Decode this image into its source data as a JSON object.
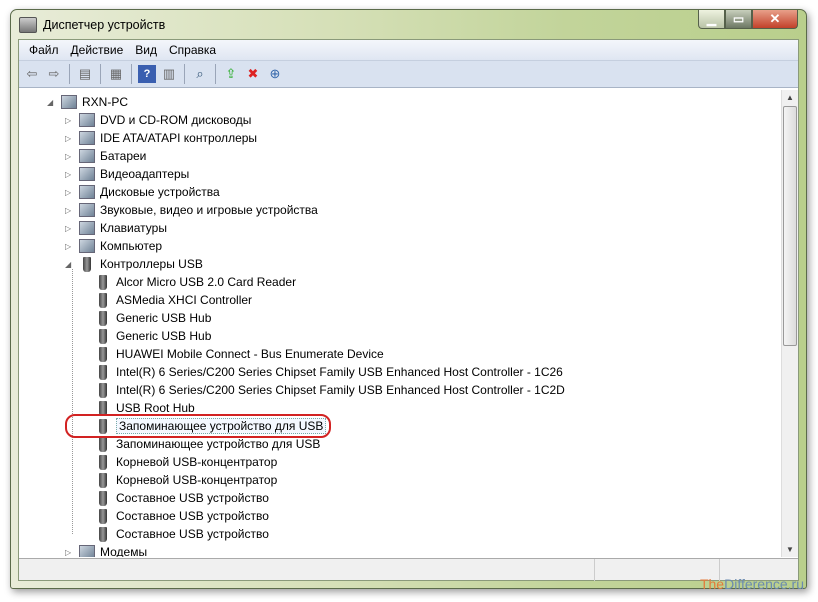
{
  "window": {
    "title": "Диспетчер устройств"
  },
  "menu": [
    "Файл",
    "Действие",
    "Вид",
    "Справка"
  ],
  "toolbar": [
    "back-icon",
    "forward-icon",
    "show-hide-tree-icon",
    "properties-icon",
    "help-icon",
    "action-pane-icon",
    "scan-hardware-icon",
    "update-driver-icon",
    "disable-device-icon",
    "uninstall-device-icon"
  ],
  "tree": {
    "root": "RXN-PC",
    "categories_before": [
      "DVD и CD-ROM дисководы",
      "IDE ATA/ATAPI контроллеры",
      "Батареи",
      "Видеоадаптеры",
      "Дисковые устройства",
      "Звуковые, видео и игровые устройства",
      "Клавиатуры",
      "Компьютер"
    ],
    "expanded": "Контроллеры USB",
    "usb_children": [
      "Alcor Micro USB 2.0 Card Reader",
      "ASMedia XHCI Controller",
      "Generic USB Hub",
      "Generic USB Hub",
      "HUAWEI Mobile Connect - Bus Enumerate Device",
      "Intel(R) 6 Series/C200 Series Chipset Family USB Enhanced Host Controller - 1C26",
      "Intel(R) 6 Series/C200 Series Chipset Family USB Enhanced Host Controller - 1C2D",
      "USB Root Hub",
      "Запоминающее устройство для USB",
      "Запоминающее устройство для USB",
      "Корневой USB-концентратор",
      "Корневой USB-концентратор",
      "Составное USB устройство",
      "Составное USB устройство",
      "Составное USB устройство"
    ],
    "selected_index": 8,
    "categories_after": [
      "Модемы"
    ]
  },
  "highlight_color": "#d22222",
  "watermark": {
    "a": "The",
    "b": "Difference.ru"
  }
}
